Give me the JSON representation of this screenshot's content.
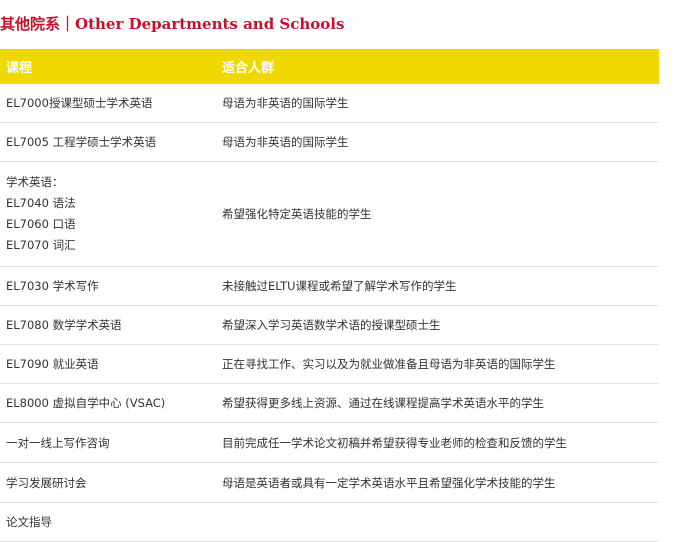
{
  "heading": "其他院系｜Other Departments and Schools",
  "table": {
    "headers": [
      "课程",
      "适合人群"
    ],
    "rows": [
      {
        "course": [
          "EL7000授课型硕士学术英语"
        ],
        "audience": "母语为非英语的国际学生"
      },
      {
        "course": [
          "EL7005 工程学硕士学术英语"
        ],
        "audience": "母语为非英语的国际学生"
      },
      {
        "course": [
          "学术英语：",
          "EL7040 语法",
          "EL7060 口语",
          "EL7070 词汇"
        ],
        "audience": "希望强化特定英语技能的学生"
      },
      {
        "course": [
          "EL7030 学术写作"
        ],
        "audience": "未接触过ELTU课程或希望了解学术写作的学生"
      },
      {
        "course": [
          "EL7080 数学学术英语"
        ],
        "audience": "希望深入学习英语数学术语的授课型硕士生"
      },
      {
        "course": [
          "EL7090 就业英语"
        ],
        "audience": "正在寻找工作、实习以及为就业做准备且母语为非英语的国际学生"
      },
      {
        "course": [
          "EL8000 虚拟自学中心 (VSAC)"
        ],
        "audience": "希望获得更多线上资源、通过在线课程提高学术英语水平的学生"
      },
      {
        "course": [
          "一对一线上写作咨询"
        ],
        "audience": "目前完成任一学术论文初稿并希望获得专业老师的检查和反馈的学生"
      },
      {
        "course": [
          "学习发展研讨会"
        ],
        "audience": "母语是英语者或具有一定学术英语水平且希望强化学术技能的学生"
      },
      {
        "course": [
          "论文指导"
        ],
        "audience": ""
      }
    ]
  }
}
